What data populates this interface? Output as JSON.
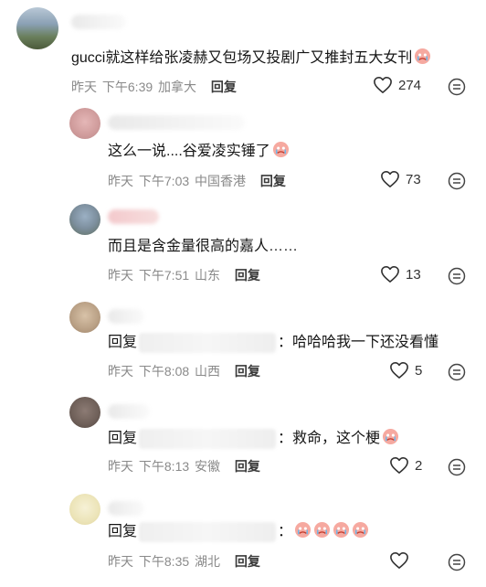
{
  "comments": [
    {
      "text": "gucci就这样给张凌赫又包场又投剧广又推封五大女刊",
      "date": "昨天",
      "time": "下午6:39",
      "location": "加拿大",
      "reply_label": "回复",
      "likes": "274",
      "emoji": "crying-face-icon"
    },
    {
      "text": "这么一说....谷爱凌实锤了",
      "date": "昨天",
      "time": "下午7:03",
      "location": "中国香港",
      "reply_label": "回复",
      "likes": "73",
      "emoji": "crying-face-icon"
    },
    {
      "text": "而且是含金量很高的嘉人……",
      "date": "昨天",
      "time": "下午7:51",
      "location": "山东",
      "reply_label": "回复",
      "likes": "13"
    },
    {
      "prefix": "回复",
      "suffix": "：哈哈哈我一下还没看懂",
      "date": "昨天",
      "time": "下午8:08",
      "location": "山西",
      "reply_label": "回复",
      "likes": "5"
    },
    {
      "prefix": "回复",
      "suffix": "：救命，这个梗",
      "date": "昨天",
      "time": "下午8:13",
      "location": "安徽",
      "reply_label": "回复",
      "likes": "2",
      "emoji": "crying-face-icon"
    },
    {
      "prefix": "回复",
      "suffix": "：",
      "date": "昨天",
      "time": "下午8:35",
      "location": "湖北",
      "reply_label": "回复",
      "likes": "",
      "emoji": "crying-face-icon"
    }
  ],
  "colors": {
    "meta_text": "#8a8a8a",
    "content_text": "#161616",
    "reply_button": "#3a3a3a",
    "emoji_face": "#f6a9a0"
  }
}
